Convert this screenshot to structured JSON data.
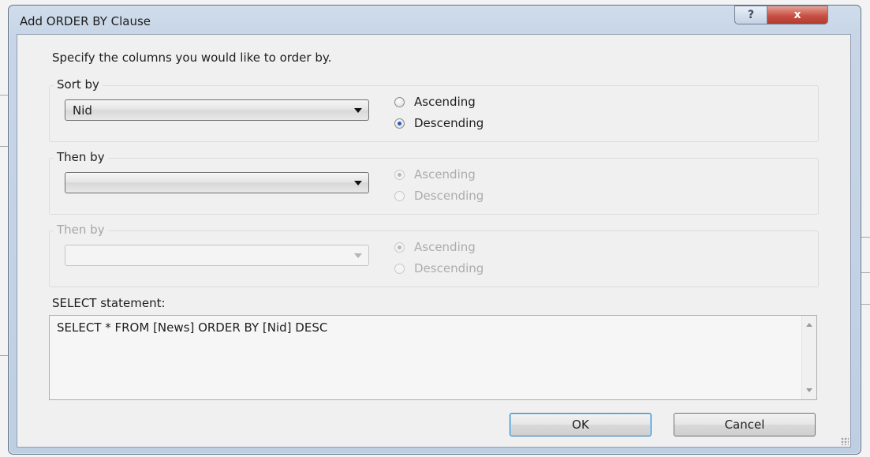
{
  "dialog": {
    "title": "Add ORDER BY Clause",
    "help_glyph": "?",
    "close_glyph": "x",
    "instruction": "Specify the columns you would like to order by."
  },
  "sort_groups": [
    {
      "label": "Sort by",
      "column_value": "Nid",
      "enabled": true,
      "ascending_label": "Ascending",
      "descending_label": "Descending",
      "selected": "Descending"
    },
    {
      "label": "Then by",
      "column_value": "",
      "enabled": true,
      "ascending_label": "Ascending",
      "descending_label": "Descending",
      "selected": "Ascending",
      "radios_enabled": false
    },
    {
      "label": "Then by",
      "column_value": "",
      "enabled": false,
      "ascending_label": "Ascending",
      "descending_label": "Descending",
      "selected": "Ascending",
      "radios_enabled": false
    }
  ],
  "select_statement": {
    "label": "SELECT statement:",
    "sql": "SELECT * FROM [News] ORDER BY [Nid] DESC"
  },
  "buttons": {
    "ok": "OK",
    "cancel": "Cancel"
  },
  "colors": {
    "title_bar": "#c7d5e6",
    "close_button": "#c75044",
    "dialog_background": "#f0f0f0"
  }
}
